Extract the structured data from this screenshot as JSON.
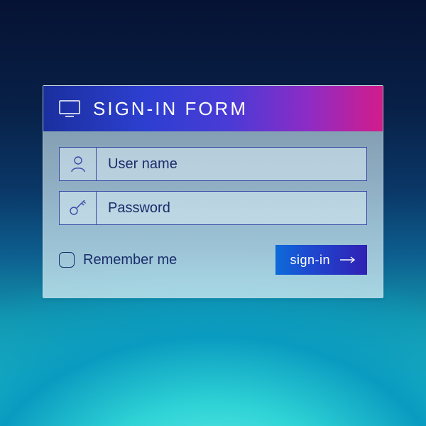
{
  "header": {
    "title": "SIGN-IN FORM",
    "icon": "monitor-icon"
  },
  "fields": {
    "username": {
      "placeholder": "User name",
      "value": "",
      "icon": "user-icon"
    },
    "password": {
      "placeholder": "Password",
      "value": "",
      "icon": "key-icon"
    }
  },
  "remember": {
    "label": "Remember me",
    "checked": false
  },
  "submit": {
    "label": "sign-in",
    "icon": "arrow-right-icon"
  },
  "colors": {
    "header_gradient": [
      "#1a2f9e",
      "#2d3fd0",
      "#4a3bd6",
      "#8d2cc5",
      "#d21c8b"
    ],
    "button_gradient": [
      "#0d6ad9",
      "#1f47cf",
      "#3020b4"
    ],
    "outline": "#3a4aa8",
    "text": "#1b2d6b"
  }
}
